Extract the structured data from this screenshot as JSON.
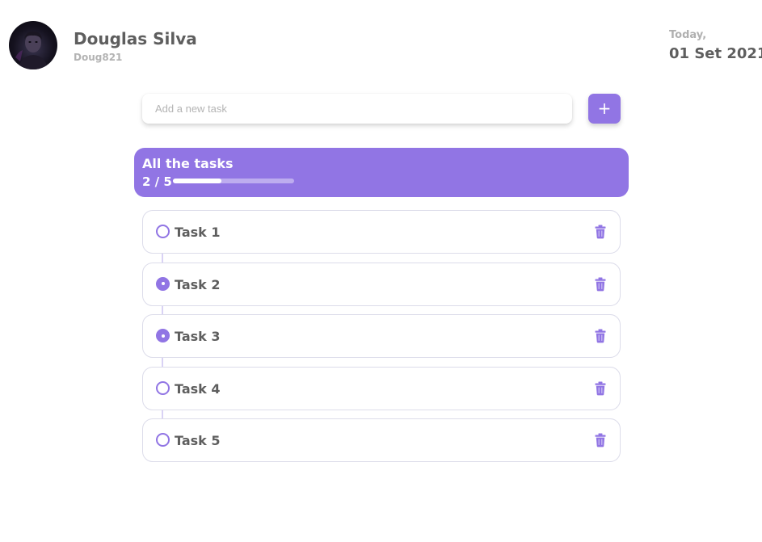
{
  "user": {
    "name": "Douglas Silva",
    "handle": "Doug821",
    "avatar_icon": "user-photo-avatar"
  },
  "date": {
    "label": "Today,",
    "value": "01 Set 2021"
  },
  "new_task": {
    "placeholder": "Add a new task",
    "value": "",
    "add_label": "+"
  },
  "summary": {
    "title": "All the tasks",
    "count": "2 / 5",
    "completed": 2,
    "total": 5
  },
  "tasks": [
    {
      "label": "Task 1",
      "done": false,
      "delete_icon": "trash-icon"
    },
    {
      "label": "Task 2",
      "done": true,
      "delete_icon": "trash-icon"
    },
    {
      "label": "Task 3",
      "done": true,
      "delete_icon": "trash-icon"
    },
    {
      "label": "Task 4",
      "done": false,
      "delete_icon": "trash-icon"
    },
    {
      "label": "Task 5",
      "done": false,
      "delete_icon": "trash-icon"
    }
  ],
  "colors": {
    "accent": "#9175e4",
    "text": "#5e5e5e",
    "muted": "#b0b0b0",
    "card_border": "#dcdcea"
  }
}
